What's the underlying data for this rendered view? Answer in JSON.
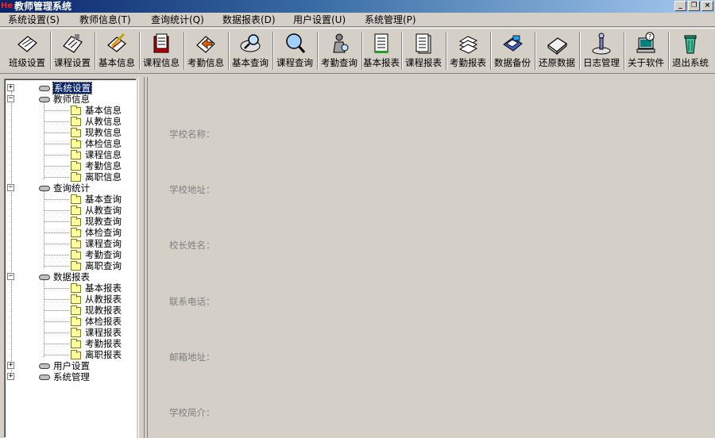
{
  "window": {
    "icon_text": "He",
    "title": "教师管理系统",
    "minimize": "_",
    "restore": "❐",
    "close": "×"
  },
  "menu": [
    "系统设置(S)",
    "教师信息(T)",
    "查询统计(Q)",
    "数据报表(D)",
    "用户设置(U)",
    "系统管理(P)"
  ],
  "toolbar": [
    {
      "label": "班级设置",
      "icon": "class-settings-icon"
    },
    {
      "label": "课程设置",
      "icon": "course-settings-icon"
    },
    {
      "label": "基本信息",
      "icon": "basic-info-icon"
    },
    {
      "label": "课程信息",
      "icon": "course-info-icon"
    },
    {
      "label": "考勤信息",
      "icon": "attendance-info-icon"
    },
    {
      "label": "基本查询",
      "icon": "basic-query-icon"
    },
    {
      "label": "课程查询",
      "icon": "course-query-icon"
    },
    {
      "label": "考勤查询",
      "icon": "attendance-query-icon"
    },
    {
      "label": "基本报表",
      "icon": "basic-report-icon"
    },
    {
      "label": "课程报表",
      "icon": "course-report-icon"
    },
    {
      "label": "考勤报表",
      "icon": "attendance-report-icon"
    },
    {
      "label": "数据备份",
      "icon": "backup-icon"
    },
    {
      "label": "还原数据",
      "icon": "restore-icon"
    },
    {
      "label": "日志管理",
      "icon": "log-icon"
    },
    {
      "label": "关于软件",
      "icon": "about-icon"
    },
    {
      "label": "退出系统",
      "icon": "exit-icon"
    }
  ],
  "tree": [
    {
      "label": "系统设置",
      "expanded": false,
      "selected": true,
      "children": []
    },
    {
      "label": "教师信息",
      "expanded": true,
      "children": [
        "基本信息",
        "从教信息",
        "现教信息",
        "体检信息",
        "课程信息",
        "考勤信息",
        "离职信息"
      ]
    },
    {
      "label": "查询统计",
      "expanded": true,
      "children": [
        "基本查询",
        "从教查询",
        "现教查询",
        "体检查询",
        "课程查询",
        "考勤查询",
        "离职查询"
      ]
    },
    {
      "label": "数据报表",
      "expanded": true,
      "children": [
        "基本报表",
        "从教报表",
        "现教报表",
        "体检报表",
        "课程报表",
        "考勤报表",
        "离职报表"
      ]
    },
    {
      "label": "用户设置",
      "expanded": false,
      "children": []
    },
    {
      "label": "系统管理",
      "expanded": false,
      "children": []
    }
  ],
  "form": {
    "school_name": "学校名称：",
    "school_address": "学校地址：",
    "principal_name": "校长姓名：",
    "phone": "联系电话：",
    "email": "邮箱地址：",
    "intro": "学校简介："
  }
}
